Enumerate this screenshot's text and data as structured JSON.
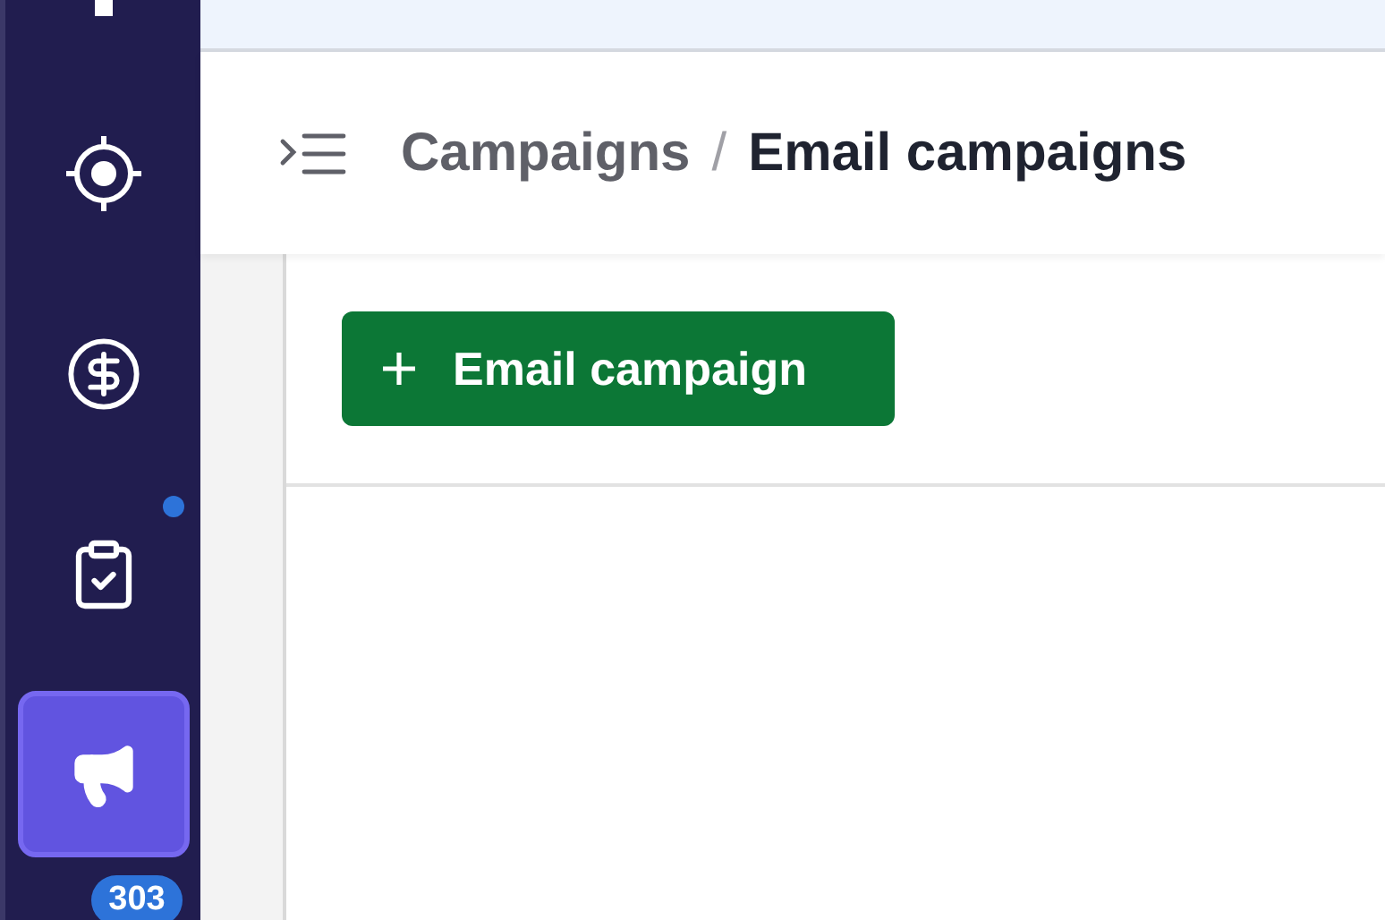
{
  "sidebar": {
    "items": [
      {
        "selected": false
      },
      {
        "selected": false,
        "dot": false
      },
      {
        "selected": false,
        "dot": false
      },
      {
        "selected": false,
        "dot": true
      },
      {
        "selected": true,
        "dot": false
      }
    ],
    "badge": "303"
  },
  "breadcrumb": [
    {
      "label": "Campaigns",
      "current": false
    },
    {
      "label": "Email campaigns",
      "current": true
    }
  ],
  "separator": "/",
  "actions": [
    {
      "label": "Email campaign"
    }
  ]
}
